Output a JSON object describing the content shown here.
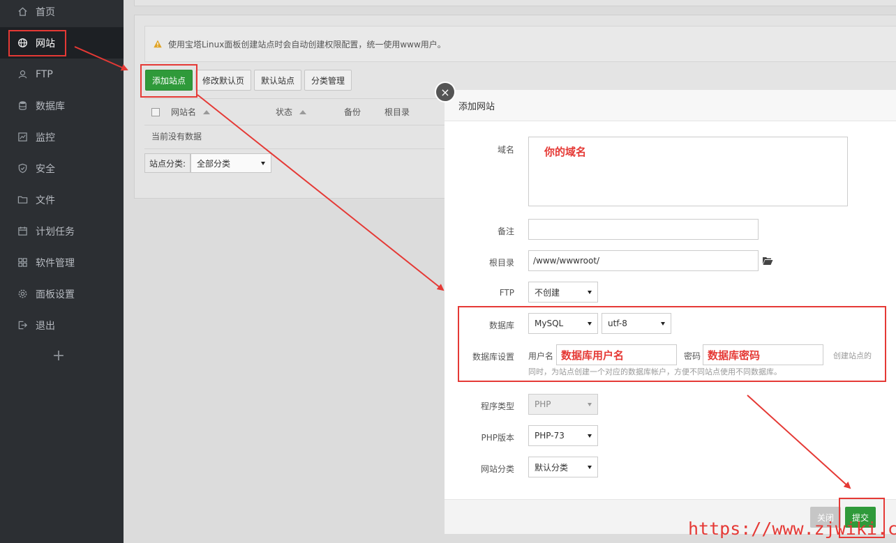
{
  "sidebar": {
    "items": [
      {
        "label": "首页",
        "icon": "home-icon"
      },
      {
        "label": "网站",
        "icon": "globe-icon",
        "active": true
      },
      {
        "label": "FTP",
        "icon": "ftp-icon"
      },
      {
        "label": "数据库",
        "icon": "database-icon"
      },
      {
        "label": "监控",
        "icon": "monitor-icon"
      },
      {
        "label": "安全",
        "icon": "shield-icon"
      },
      {
        "label": "文件",
        "icon": "folder-icon"
      },
      {
        "label": "计划任务",
        "icon": "calendar-icon"
      },
      {
        "label": "软件管理",
        "icon": "grid-icon"
      },
      {
        "label": "面板设置",
        "icon": "gear-icon"
      },
      {
        "label": "退出",
        "icon": "logout-icon"
      }
    ],
    "add_symbol": "+"
  },
  "main": {
    "alert_text": "使用宝塔Linux面板创建站点时会自动创建权限配置，统一使用www用户。",
    "buttons": {
      "add_site": "添加站点",
      "edit_default_page": "修改默认页",
      "default_site": "默认站点",
      "category_manage": "分类管理"
    },
    "table": {
      "columns": [
        "网站名",
        "状态",
        "备份",
        "根目录"
      ],
      "empty_text": "当前没有数据"
    },
    "category": {
      "label": "站点分类:",
      "value": "全部分类"
    }
  },
  "modal": {
    "title": "添加网站",
    "close_symbol": "×",
    "domain": {
      "label": "域名",
      "annotation": "你的域名"
    },
    "remark": {
      "label": "备注",
      "value": ""
    },
    "root": {
      "label": "根目录",
      "value": "/www/wwwroot/"
    },
    "ftp": {
      "label": "FTP",
      "value": "不创建"
    },
    "database": {
      "label": "数据库",
      "type": "MySQL",
      "charset": "utf-8"
    },
    "db_settings": {
      "label": "数据库设置",
      "user_label": "用户名",
      "user_annotation": "数据库用户名",
      "pass_label": "密码",
      "pass_annotation": "数据库密码",
      "hint_line1": "创建站点的",
      "hint_line2": "同时，为站点创建一个对应的数据库帐户，方便不同站点使用不同数据库。"
    },
    "program_type": {
      "label": "程序类型",
      "value": "PHP"
    },
    "php_version": {
      "label": "PHP版本",
      "value": "PHP-73"
    },
    "site_category": {
      "label": "网站分类",
      "value": "默认分类"
    },
    "footer": {
      "close": "关闭",
      "submit": "提交"
    }
  },
  "watermark": "https://www.zjwiki.com",
  "colors": {
    "annotation_red": "#e53935",
    "accent_green": "#2f9a3a",
    "sidebar_bg": "#2c2f33"
  }
}
